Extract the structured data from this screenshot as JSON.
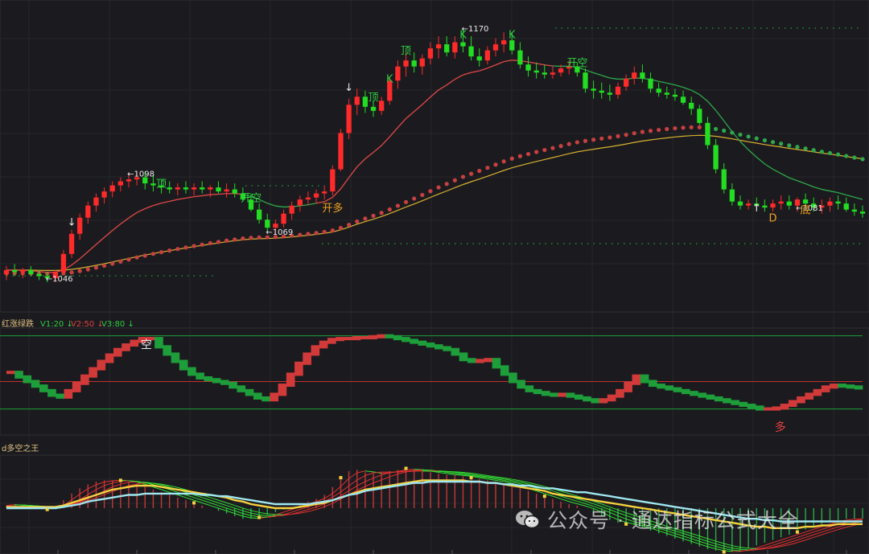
{
  "chart_data": [
    {
      "type": "candlestick",
      "title": "",
      "ylim": [
        1030,
        1180
      ],
      "price_labels": [
        {
          "text": "←1046",
          "idx": 6,
          "price": 1046
        },
        {
          "text": "←1098",
          "idx": 16,
          "price": 1098
        },
        {
          "text": "←1069",
          "idx": 33,
          "price": 1069
        },
        {
          "text": "←1170",
          "idx": 57,
          "price": 1170
        },
        {
          "text": "←1081",
          "idx": 98,
          "price": 1081
        }
      ],
      "signals": [
        {
          "text": "↓",
          "idx": 8,
          "price": 1072,
          "color": "#e8e8e8"
        },
        {
          "text": "顶",
          "idx": 19,
          "price": 1091,
          "color": "#2ecc40"
        },
        {
          "text": "开空",
          "idx": 30,
          "price": 1084,
          "color": "#2ecc40"
        },
        {
          "text": "开多",
          "idx": 40,
          "price": 1079,
          "color": "#f0a020"
        },
        {
          "text": "↓",
          "idx": 42,
          "price": 1139,
          "color": "#e8e8e8"
        },
        {
          "text": "顶",
          "idx": 45,
          "price": 1134,
          "color": "#2ecc40"
        },
        {
          "text": "K",
          "idx": 47,
          "price": 1143,
          "color": "#2ecc40"
        },
        {
          "text": "顶",
          "idx": 49,
          "price": 1157,
          "color": "#2ecc40"
        },
        {
          "text": "K",
          "idx": 56,
          "price": 1165,
          "color": "#2ecc40"
        },
        {
          "text": "K",
          "idx": 62,
          "price": 1165,
          "color": "#2ecc40"
        },
        {
          "text": "开空",
          "idx": 70,
          "price": 1151,
          "color": "#2ecc40"
        },
        {
          "text": "↑",
          "idx": 92,
          "price": 1079,
          "color": "#e8e8e8"
        },
        {
          "text": "D",
          "idx": 94,
          "price": 1074,
          "color": "#f0a020"
        },
        {
          "text": "底",
          "idx": 98,
          "price": 1078,
          "color": "#f0a020"
        }
      ],
      "candles": [
        [
          1048,
          1052,
          1045,
          1050
        ],
        [
          1050,
          1053,
          1047,
          1049
        ],
        [
          1049,
          1051,
          1046,
          1050
        ],
        [
          1050,
          1052,
          1047,
          1048
        ],
        [
          1048,
          1050,
          1045,
          1047
        ],
        [
          1047,
          1049,
          1044,
          1046
        ],
        [
          1046,
          1050,
          1044,
          1049
        ],
        [
          1049,
          1060,
          1048,
          1058
        ],
        [
          1058,
          1070,
          1056,
          1068
        ],
        [
          1068,
          1078,
          1065,
          1076
        ],
        [
          1076,
          1084,
          1073,
          1082
        ],
        [
          1082,
          1088,
          1079,
          1086
        ],
        [
          1086,
          1091,
          1083,
          1089
        ],
        [
          1089,
          1094,
          1086,
          1092
        ],
        [
          1092,
          1096,
          1089,
          1094
        ],
        [
          1094,
          1098,
          1091,
          1095
        ],
        [
          1095,
          1099,
          1092,
          1096
        ],
        [
          1096,
          1099,
          1090,
          1093
        ],
        [
          1093,
          1097,
          1089,
          1092
        ],
        [
          1092,
          1095,
          1088,
          1091
        ],
        [
          1091,
          1094,
          1088,
          1090
        ],
        [
          1090,
          1093,
          1087,
          1091
        ],
        [
          1091,
          1094,
          1088,
          1090
        ],
        [
          1090,
          1093,
          1087,
          1091
        ],
        [
          1091,
          1094,
          1088,
          1090
        ],
        [
          1090,
          1092,
          1086,
          1091
        ],
        [
          1091,
          1094,
          1088,
          1089
        ],
        [
          1089,
          1093,
          1086,
          1090
        ],
        [
          1090,
          1093,
          1086,
          1088
        ],
        [
          1088,
          1091,
          1084,
          1085
        ],
        [
          1085,
          1088,
          1079,
          1080
        ],
        [
          1080,
          1083,
          1073,
          1075
        ],
        [
          1075,
          1078,
          1069,
          1071
        ],
        [
          1071,
          1075,
          1068,
          1073
        ],
        [
          1073,
          1080,
          1071,
          1078
        ],
        [
          1078,
          1084,
          1075,
          1082
        ],
        [
          1082,
          1087,
          1079,
          1085
        ],
        [
          1085,
          1089,
          1082,
          1086
        ],
        [
          1086,
          1090,
          1083,
          1088
        ],
        [
          1088,
          1092,
          1085,
          1089
        ],
        [
          1089,
          1102,
          1087,
          1100
        ],
        [
          1100,
          1120,
          1099,
          1118
        ],
        [
          1118,
          1135,
          1115,
          1132
        ],
        [
          1132,
          1140,
          1127,
          1136
        ],
        [
          1136,
          1139,
          1128,
          1131
        ],
        [
          1131,
          1134,
          1126,
          1129
        ],
        [
          1129,
          1136,
          1127,
          1134
        ],
        [
          1134,
          1146,
          1132,
          1144
        ],
        [
          1144,
          1154,
          1140,
          1151
        ],
        [
          1151,
          1158,
          1146,
          1154
        ],
        [
          1154,
          1158,
          1148,
          1151
        ],
        [
          1151,
          1157,
          1147,
          1155
        ],
        [
          1155,
          1163,
          1152,
          1160
        ],
        [
          1160,
          1166,
          1155,
          1162
        ],
        [
          1162,
          1166,
          1156,
          1158
        ],
        [
          1158,
          1166,
          1155,
          1163
        ],
        [
          1163,
          1170,
          1158,
          1161
        ],
        [
          1161,
          1166,
          1154,
          1156
        ],
        [
          1156,
          1160,
          1151,
          1154
        ],
        [
          1154,
          1161,
          1152,
          1159
        ],
        [
          1159,
          1165,
          1156,
          1162
        ],
        [
          1162,
          1168,
          1158,
          1164
        ],
        [
          1164,
          1168,
          1157,
          1159
        ],
        [
          1159,
          1163,
          1150,
          1152
        ],
        [
          1152,
          1156,
          1146,
          1149
        ],
        [
          1149,
          1153,
          1145,
          1148
        ],
        [
          1148,
          1152,
          1145,
          1147
        ],
        [
          1147,
          1151,
          1145,
          1148
        ],
        [
          1148,
          1152,
          1146,
          1150
        ],
        [
          1150,
          1154,
          1147,
          1151
        ],
        [
          1151,
          1153,
          1146,
          1148
        ],
        [
          1148,
          1150,
          1138,
          1140
        ],
        [
          1140,
          1144,
          1135,
          1139
        ],
        [
          1139,
          1143,
          1135,
          1138
        ],
        [
          1138,
          1142,
          1134,
          1137
        ],
        [
          1137,
          1143,
          1135,
          1141
        ],
        [
          1141,
          1147,
          1139,
          1145
        ],
        [
          1145,
          1151,
          1142,
          1148
        ],
        [
          1148,
          1152,
          1143,
          1145
        ],
        [
          1145,
          1148,
          1138,
          1140
        ],
        [
          1140,
          1143,
          1136,
          1138
        ],
        [
          1138,
          1141,
          1135,
          1137
        ],
        [
          1137,
          1140,
          1134,
          1136
        ],
        [
          1136,
          1139,
          1132,
          1133
        ],
        [
          1133,
          1136,
          1127,
          1130
        ],
        [
          1130,
          1132,
          1122,
          1123
        ],
        [
          1123,
          1126,
          1110,
          1112
        ],
        [
          1112,
          1115,
          1098,
          1100
        ],
        [
          1100,
          1103,
          1088,
          1090
        ],
        [
          1090,
          1093,
          1082,
          1084
        ],
        [
          1084,
          1087,
          1080,
          1082
        ],
        [
          1082,
          1085,
          1080,
          1083
        ],
        [
          1083,
          1086,
          1080,
          1082
        ],
        [
          1082,
          1085,
          1079,
          1081
        ],
        [
          1081,
          1085,
          1079,
          1083
        ],
        [
          1083,
          1087,
          1080,
          1084
        ],
        [
          1084,
          1087,
          1080,
          1082
        ],
        [
          1082,
          1086,
          1079,
          1085
        ],
        [
          1085,
          1088,
          1081,
          1083
        ],
        [
          1083,
          1086,
          1079,
          1081
        ],
        [
          1081,
          1085,
          1078,
          1082
        ],
        [
          1082,
          1086,
          1079,
          1084
        ],
        [
          1084,
          1087,
          1080,
          1083
        ],
        [
          1083,
          1086,
          1079,
          1080
        ],
        [
          1080,
          1083,
          1077,
          1079
        ],
        [
          1079,
          1082,
          1076,
          1078
        ]
      ]
    },
    {
      "type": "step-line",
      "title": "红涨绿跌",
      "legend": [
        {
          "text": "V1:20",
          "arrow": "↓",
          "color": "#2ecc40"
        },
        {
          "text": "V2:50",
          "arrow": "↓",
          "color": "#e04040"
        },
        {
          "text": "V3:80",
          "arrow": "↓",
          "color": "#2ecc40"
        }
      ],
      "ylim": [
        -5,
        105
      ],
      "levels": [
        {
          "value": 20,
          "color": "#1e9e3a"
        },
        {
          "value": 50,
          "color": "#c03030"
        },
        {
          "value": 100,
          "color": "#1e9e3a"
        }
      ],
      "annotations": [
        {
          "text": "空",
          "idx": 17,
          "value": 100,
          "color": "#e8e8e8"
        },
        {
          "text": "多",
          "idx": 94,
          "value": 10,
          "color": "#e04040"
        }
      ],
      "values": [
        60,
        60,
        55,
        50,
        45,
        40,
        35,
        33,
        40,
        48,
        56,
        64,
        72,
        79,
        85,
        90,
        94,
        97,
        97,
        88,
        80,
        72,
        64,
        58,
        54,
        52,
        50,
        48,
        44,
        40,
        36,
        32,
        30,
        36,
        46,
        58,
        70,
        80,
        88,
        93,
        96,
        97,
        97,
        98,
        98,
        99,
        100,
        99,
        97,
        95,
        93,
        91,
        89,
        87,
        85,
        80,
        74,
        72,
        73,
        74,
        66,
        58,
        50,
        44,
        40,
        38,
        36,
        35,
        36,
        34,
        32,
        30,
        28,
        30,
        34,
        40,
        48,
        56,
        50,
        46,
        44,
        42,
        40,
        38,
        36,
        34,
        32,
        30,
        28,
        26,
        24,
        22,
        20,
        20,
        21,
        24,
        28,
        32,
        36,
        40,
        44,
        46,
        45,
        44,
        43
      ]
    },
    {
      "type": "histogram",
      "title": "d多空之王",
      "ylim": [
        -3.5,
        3.5
      ],
      "values": [
        0.2,
        0.3,
        0.2,
        0.1,
        0.0,
        -0.1,
        0.1,
        0.6,
        1.1,
        1.5,
        1.8,
        2.0,
        2.1,
        2.1,
        2.1,
        2.0,
        1.8,
        1.6,
        1.4,
        1.2,
        1.0,
        0.8,
        0.6,
        0.4,
        0.2,
        0.0,
        -0.2,
        -0.4,
        -0.6,
        -0.8,
        -0.8,
        -0.7,
        -0.5,
        -0.3,
        -0.1,
        0.1,
        0.3,
        0.5,
        0.7,
        1.0,
        1.6,
        2.3,
        2.8,
        2.9,
        2.7,
        2.6,
        2.6,
        2.8,
        2.9,
        3.0,
        2.9,
        2.8,
        2.7,
        2.6,
        2.5,
        2.5,
        2.4,
        2.3,
        2.2,
        2.1,
        2.0,
        1.9,
        1.7,
        1.5,
        1.3,
        1.1,
        0.9,
        0.7,
        0.5,
        0.3,
        0.2,
        0.0,
        -0.3,
        -0.6,
        -0.9,
        -1.1,
        -1.2,
        -1.3,
        -1.5,
        -1.7,
        -1.9,
        -2.1,
        -2.3,
        -2.5,
        -2.7,
        -2.9,
        -3.1,
        -3.2,
        -3.3,
        -3.3,
        -3.2,
        -3.0,
        -2.8,
        -2.6,
        -2.4,
        -2.2,
        -2.0,
        -1.8,
        -1.6,
        -1.4,
        -1.2,
        -1.0,
        -0.9,
        -0.8,
        -0.8,
        -0.8
      ],
      "lines": [
        {
          "color": "#f5d040",
          "values": [
            0.1,
            0.1,
            0.1,
            0.1,
            0.1,
            0.1,
            0.1,
            0.2,
            0.4,
            0.6,
            0.8,
            1.0,
            1.2,
            1.4,
            1.5,
            1.6,
            1.7,
            1.7,
            1.7,
            1.6,
            1.5,
            1.4,
            1.3,
            1.2,
            1.1,
            1.0,
            0.9,
            0.8,
            0.6,
            0.5,
            0.3,
            0.2,
            0.1,
            0.0,
            0.0,
            0.0,
            0.1,
            0.2,
            0.3,
            0.4,
            0.6,
            0.8,
            1.0,
            1.2,
            1.4,
            1.5,
            1.6,
            1.7,
            1.8,
            1.9,
            2.0,
            2.1,
            2.1,
            2.1,
            2.1,
            2.1,
            2.1,
            2.0,
            2.0,
            1.9,
            1.9,
            1.8,
            1.7,
            1.6,
            1.5,
            1.4,
            1.3,
            1.1,
            1.0,
            0.9,
            0.8,
            0.7,
            0.6,
            0.5,
            0.4,
            0.3,
            0.2,
            0.1,
            0.0,
            -0.1,
            -0.2,
            -0.3,
            -0.4,
            -0.5,
            -0.6,
            -0.7,
            -0.8,
            -0.9,
            -1.0,
            -1.1,
            -1.2,
            -1.3,
            -1.4,
            -1.4,
            -1.5,
            -1.5,
            -1.5,
            -1.5,
            -1.4,
            -1.4,
            -1.3,
            -1.3,
            -1.2,
            -1.2,
            -1.2,
            -1.2
          ]
        },
        {
          "color": "#9fe6f0",
          "values": [
            0.0,
            0.0,
            0.0,
            0.0,
            0.0,
            0.0,
            0.0,
            0.1,
            0.2,
            0.3,
            0.5,
            0.6,
            0.7,
            0.8,
            0.9,
            1.0,
            1.0,
            1.1,
            1.1,
            1.1,
            1.1,
            1.1,
            1.1,
            1.1,
            1.0,
            1.0,
            0.9,
            0.9,
            0.8,
            0.7,
            0.6,
            0.5,
            0.4,
            0.3,
            0.3,
            0.3,
            0.3,
            0.3,
            0.4,
            0.5,
            0.6,
            0.8,
            1.0,
            1.1,
            1.3,
            1.4,
            1.5,
            1.6,
            1.7,
            1.8,
            1.9,
            1.9,
            2.0,
            2.0,
            2.0,
            2.0,
            2.0,
            2.0,
            2.0,
            1.9,
            1.9,
            1.8,
            1.8,
            1.7,
            1.7,
            1.6,
            1.5,
            1.5,
            1.4,
            1.3,
            1.2,
            1.2,
            1.1,
            1.0,
            0.9,
            0.8,
            0.7,
            0.6,
            0.5,
            0.4,
            0.3,
            0.2,
            0.1,
            0.0,
            -0.1,
            -0.2,
            -0.3,
            -0.4,
            -0.5,
            -0.6,
            -0.7,
            -0.8,
            -0.8,
            -0.9,
            -0.9,
            -1.0,
            -1.0,
            -1.0,
            -1.0,
            -1.0,
            -1.0,
            -1.0,
            -1.0,
            -1.0,
            -1.0,
            -1.0
          ]
        }
      ]
    }
  ],
  "watermark": "公众号 · 通达指标公式大全"
}
